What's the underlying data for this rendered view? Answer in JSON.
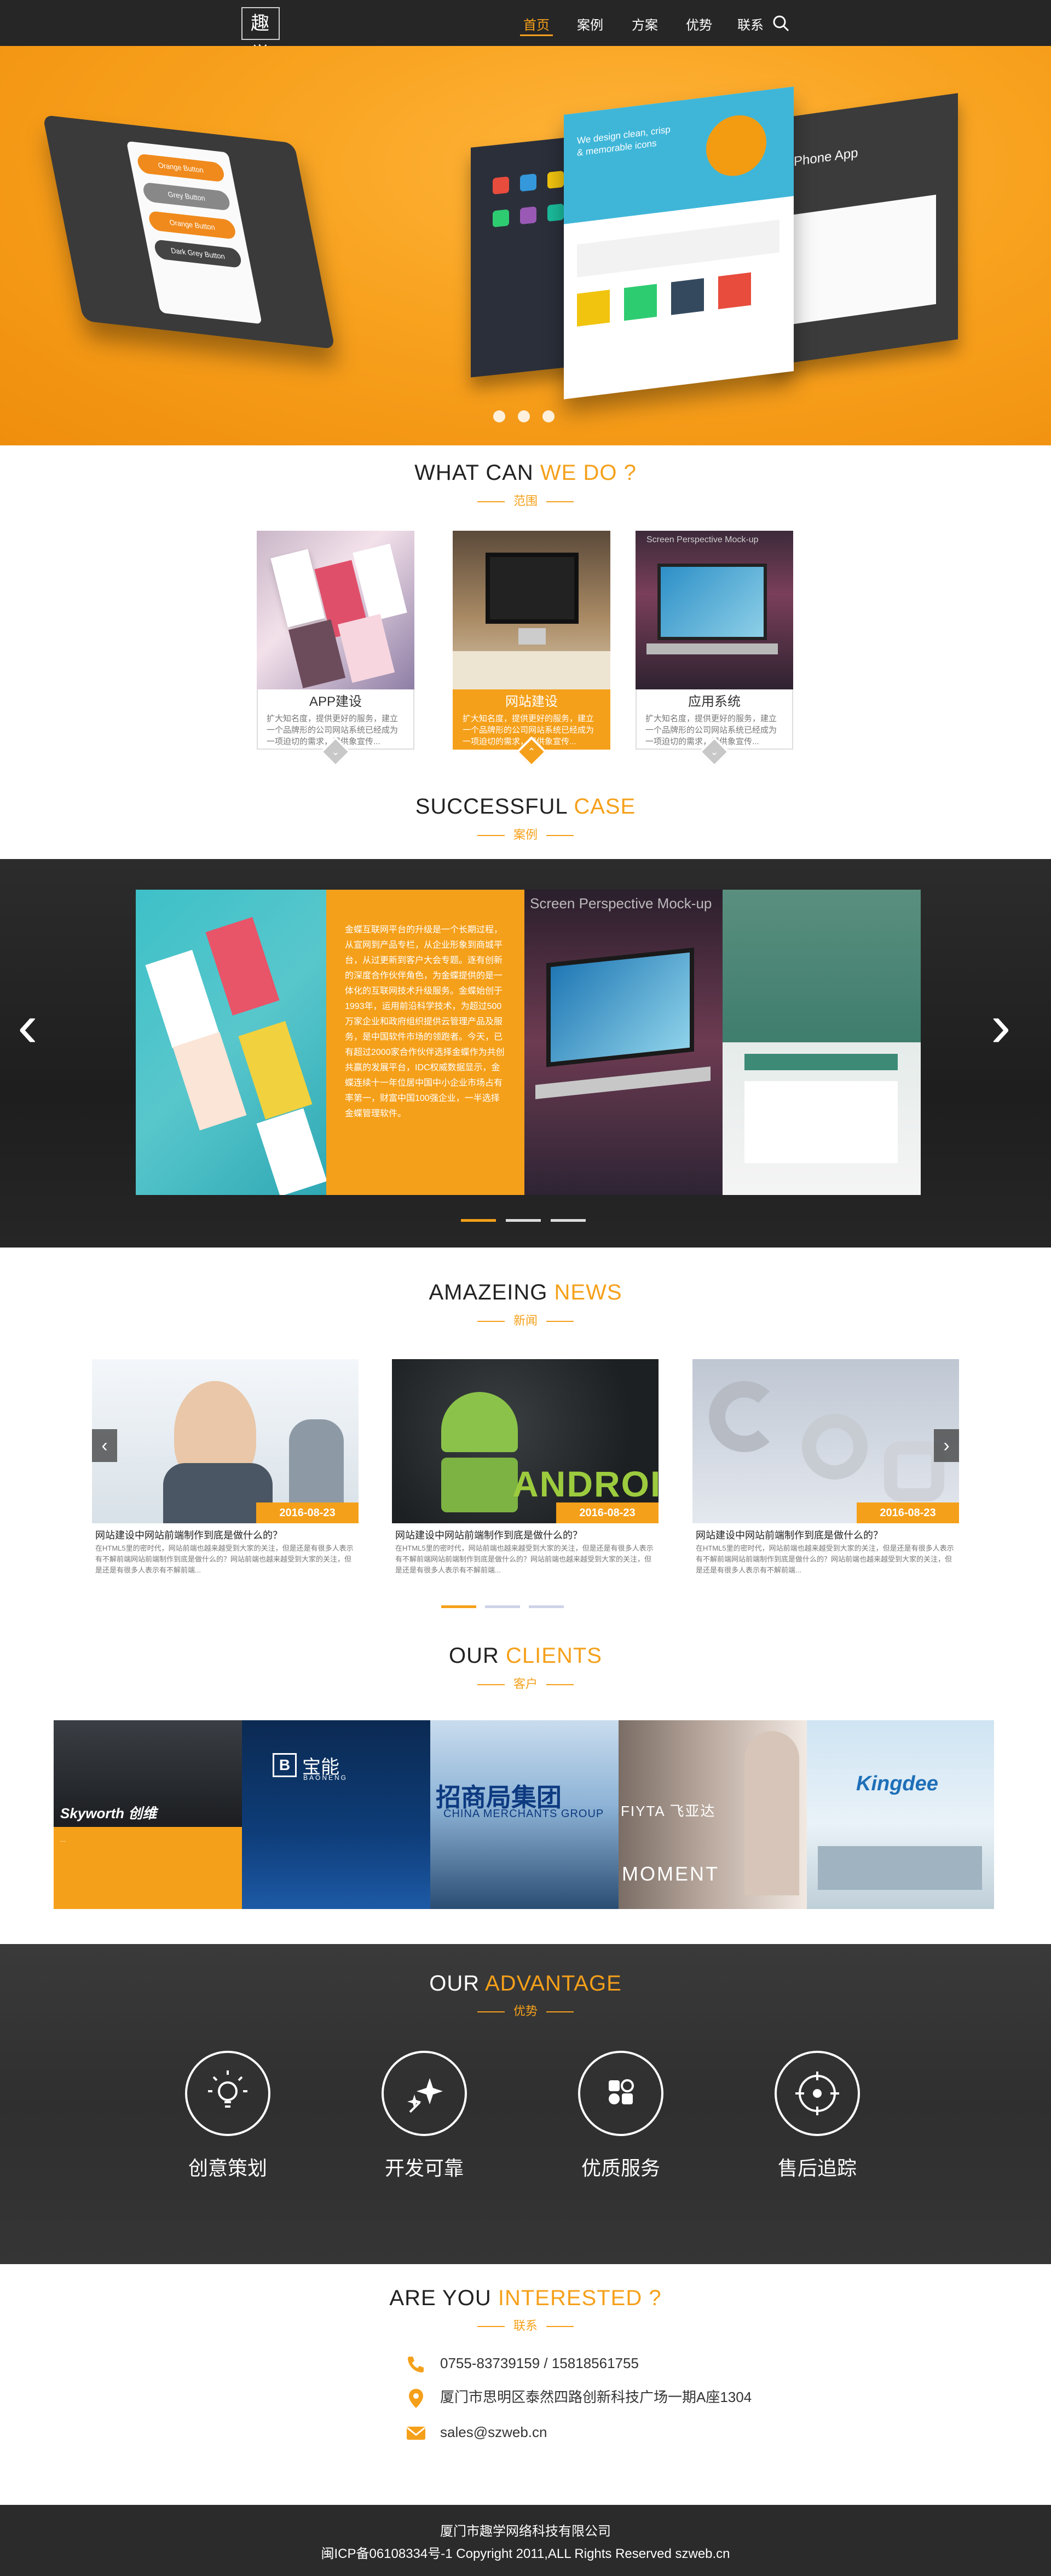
{
  "nav": {
    "logo": "趣学",
    "items": [
      "首页",
      "案例",
      "方案",
      "优势",
      "联系"
    ]
  },
  "hero": {
    "phone_buttons": [
      "Orange Button",
      "Grey Button",
      "Orange Button",
      "Dark Grey Button"
    ],
    "site_heading": "We design clean, crisp & memorable icons",
    "app_label": "Phone App",
    "slides": 3,
    "active_slide": 1
  },
  "services": {
    "title_plain": "WHAT CAN ",
    "title_hl": "WE DO ?",
    "subtitle": "范围",
    "cards": [
      {
        "title": "APP建设",
        "desc": "扩大知名度，提供更好的服务，建立一个品牌形的公司网站系统已经成为一项迫切的需求，提供象宣传..."
      },
      {
        "title": "网站建设",
        "desc": "扩大知名度，提供更好的服务，建立一个品牌形的公司网站系统已经成为一项迫切的需求，提供象宣传..."
      },
      {
        "title": "应用系统",
        "desc": "扩大知名度，提供更好的服务，建立一个品牌形的公司网站系统已经成为一项迫切的需求，提供象宣传..."
      }
    ],
    "active_index": 1
  },
  "cases": {
    "title_plain": "SUCCESSFUL ",
    "title_hl": "CASE",
    "subtitle": "案例",
    "text": "金蝶互联网平台的升级是一个长期过程，从宣网到产品专栏，从企业形象到商城平台，从过更新到客户大会专题。逐有创新的深度合作伙伴角色，为金蝶提供的是一体化的互联网技术升级服务。金蝶始创于1993年，运用前沿科学技术，为超过500万家企业和政府组织提供云管理产品及服务，是中国软件市场的领跑者。今天，已有超过2000家合作伙伴选择金蝶作为共创共赢的发展平台，IDC权威数据显示，金蝶连续十一年位居中国中小企业市场占有率第一，财富中国100强企业，一半选择金蝶管理软件。",
    "mockup_caption": "Screen Perspective Mock-up",
    "indicators": 3,
    "active_indicator": 0
  },
  "news": {
    "title_plain": "AMAZEING ",
    "title_hl": "NEWS",
    "subtitle": "新闻",
    "items": [
      {
        "date": "2016-08-23",
        "title": "网站建设中网站前端制作到底是做什么的？",
        "desc": "在HTML5里的密时代，网站前端也越来越受到大家的关注，但是还是有很多人表示有不解前端网站前端制作到底是做什么的？网站前端也越来越受到大家的关注，但是还是有很多人表示有不解前端..."
      },
      {
        "date": "2016-08-23",
        "title": "网站建设中网站前端制作到底是做什么的？",
        "desc": "在HTML5里的密时代，网站前端也越来越受到大家的关注，但是还是有很多人表示有不解前端网站前端制作到底是做什么的？网站前端也越来越受到大家的关注，但是还是有很多人表示有不解前端..."
      },
      {
        "date": "2016-08-23",
        "title": "网站建设中网站前端制作到底是做什么的？",
        "desc": "在HTML5里的密时代，网站前端也越来越受到大家的关注，但是还是有很多人表示有不解前端网站前端制作到底是做什么的？网站前端也越来越受到大家的关注，但是还是有很多人表示有不解前端..."
      }
    ],
    "android_word": "ANDROI",
    "indicators": 3,
    "active_indicator": 0
  },
  "clients": {
    "title_plain": "OUR ",
    "title_hl": "CLIENTS",
    "subtitle": "客户",
    "logos": [
      "Skyworth 创维",
      "宝能",
      "招商局集团",
      "FIYTA 飞亚达",
      "Kingdee"
    ],
    "baoneng_en": "BAONENG",
    "cmg_en": "CHINA MERCHANTS GROUP",
    "fiyta_moment": "MOMENT",
    "skyworth_caption": "..."
  },
  "advantage": {
    "title_plain": "OUR ",
    "title_hl": "ADVANTAGE",
    "subtitle": "优势",
    "items": [
      {
        "label": "创意策划",
        "icon": "lightbulb-icon"
      },
      {
        "label": "开发可靠",
        "icon": "sparkle-icon"
      },
      {
        "label": "优质服务",
        "icon": "service-icon"
      },
      {
        "label": "售后追踪",
        "icon": "target-icon"
      }
    ]
  },
  "contact": {
    "title_plain": "ARE YOU ",
    "title_hl": "INTERESTED ?",
    "subtitle": "联系",
    "phone": "0755-83739159 / 15818561755",
    "address": "厦门市思明区泰然四路创新科技广场一期A座1304",
    "email": "sales@szweb.cn"
  },
  "footer": {
    "company": "厦门市趣学网络科技有限公司",
    "copyright": "闽ICP备06108334号-1 Copyright 2011,ALL Rights Reserved szweb.cn"
  },
  "colors": {
    "accent": "#f5a01a",
    "dark": "#262626"
  }
}
